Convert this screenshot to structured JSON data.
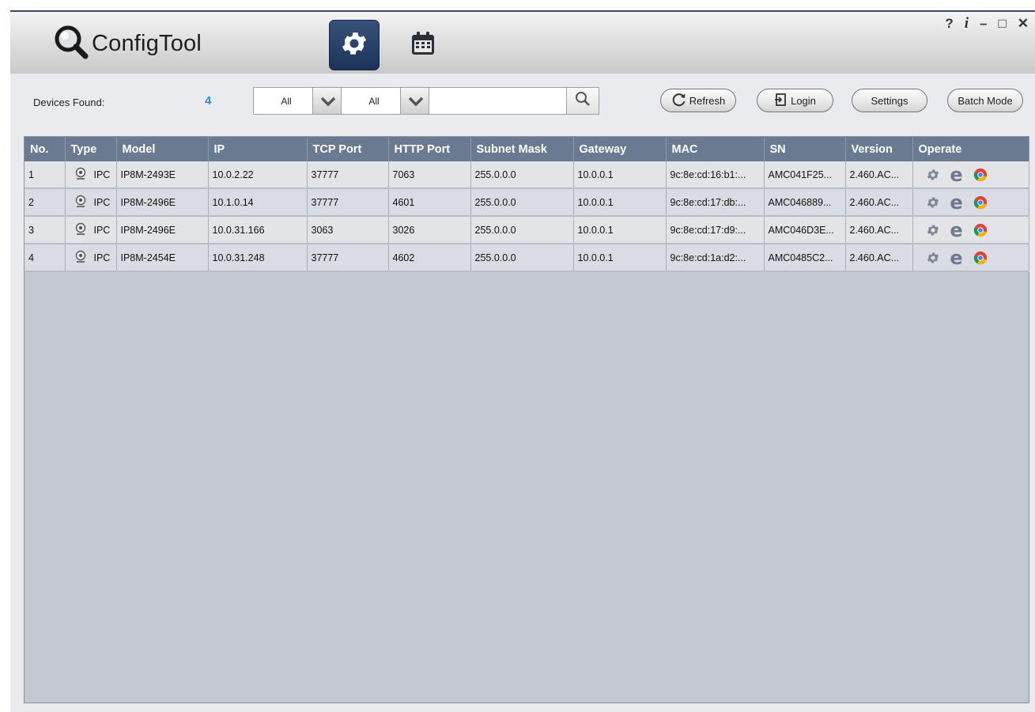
{
  "app": {
    "title": "ConfigTool",
    "window_controls": {
      "help": "?",
      "info": "i",
      "minimize": "–",
      "maximize": "□",
      "close": "✕"
    },
    "modes": [
      {
        "icon": "gear-icon",
        "active": true
      },
      {
        "icon": "calendar-icon",
        "active": false
      }
    ]
  },
  "toolbar": {
    "devices_found_label": "Devices Found:",
    "devices_found_count": "4",
    "filter1_value": "All",
    "filter2_value": "All",
    "search_value": "",
    "refresh_label": "Refresh",
    "login_label": "Login",
    "settings_label": "Settings",
    "batch_mode_label": "Batch Mode"
  },
  "table": {
    "columns": [
      "No.",
      "Type",
      "Model",
      "IP",
      "TCP Port",
      "HTTP Port",
      "Subnet Mask",
      "Gateway",
      "MAC",
      "SN",
      "Version",
      "Operate"
    ],
    "rows": [
      {
        "no": "1",
        "type": "IPC",
        "model": "IP8M-2493E",
        "ip": "10.0.2.22",
        "tcp": "37777",
        "http": "7063",
        "mask": "255.0.0.0",
        "gateway": "10.0.0.1",
        "mac": "9c:8e:cd:16:b1:...",
        "sn": "AMC041F25...",
        "version": "2.460.AC..."
      },
      {
        "no": "2",
        "type": "IPC",
        "model": "IP8M-2496E",
        "ip": "10.1.0.14",
        "tcp": "37777",
        "http": "4601",
        "mask": "255.0.0.0",
        "gateway": "10.0.0.1",
        "mac": "9c:8e:cd:17:db:...",
        "sn": "AMC046889...",
        "version": "2.460.AC..."
      },
      {
        "no": "3",
        "type": "IPC",
        "model": "IP8M-2496E",
        "ip": "10.0.31.166",
        "tcp": "3063",
        "http": "3026",
        "mask": "255.0.0.0",
        "gateway": "10.0.0.1",
        "mac": "9c:8e:cd:17:d9:...",
        "sn": "AMC046D3E...",
        "version": "2.460.AC..."
      },
      {
        "no": "4",
        "type": "IPC",
        "model": "IP8M-2454E",
        "ip": "10.0.31.248",
        "tcp": "37777",
        "http": "4602",
        "mask": "255.0.0.0",
        "gateway": "10.0.0.1",
        "mac": "9c:8e:cd:1a:d2:...",
        "sn": "AMC0485C2...",
        "version": "2.460.AC..."
      }
    ],
    "operate_icons": [
      "gear-icon",
      "ie-browser-icon",
      "chrome-browser-icon"
    ]
  },
  "colors": {
    "header_bg": "#6a7a91",
    "accent_count": "#2f86e0",
    "active_mode_bg": "#1b3258"
  }
}
